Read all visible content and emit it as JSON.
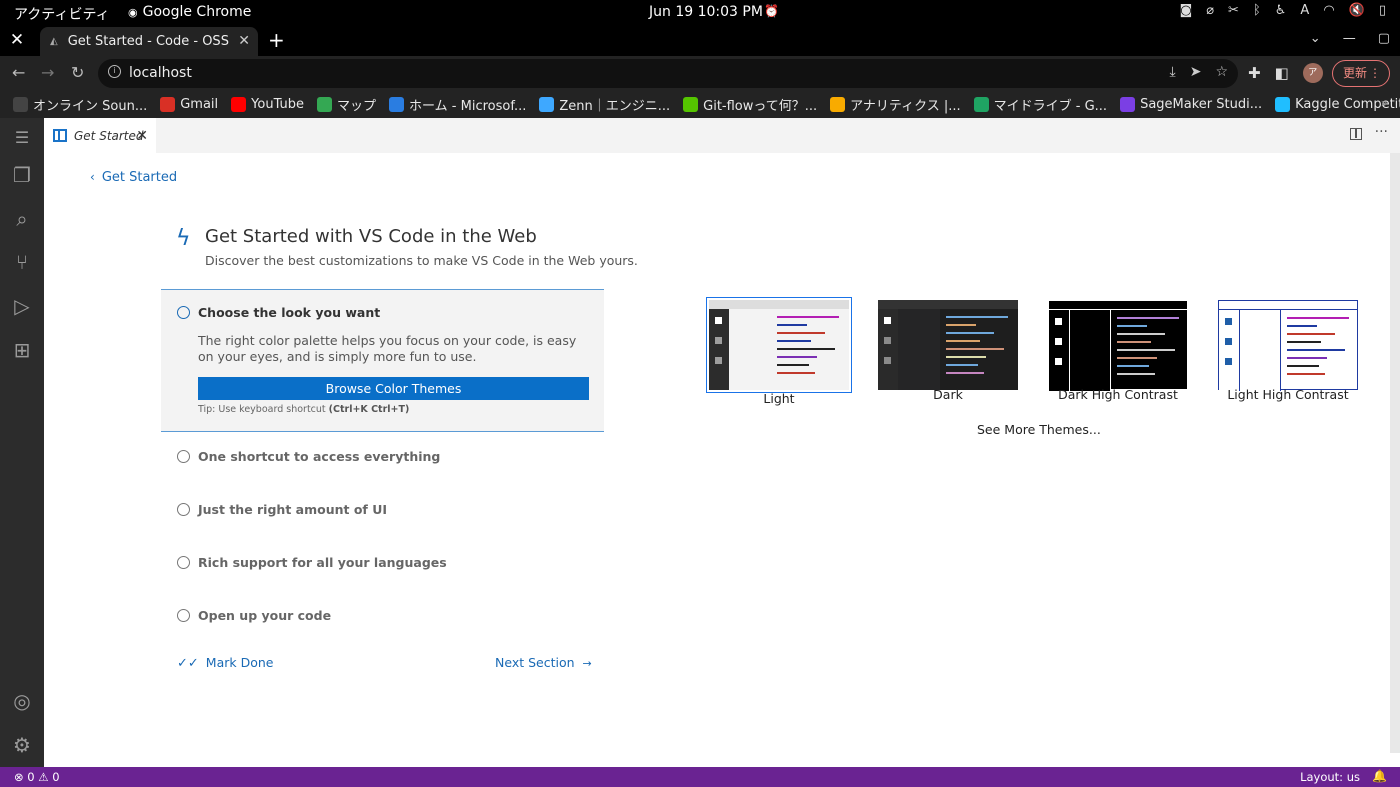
{
  "os": {
    "activities": "アクティビティ",
    "app_name": "Google Chrome",
    "clock": "Jun 19  10:03 PM",
    "input_method": "A"
  },
  "browser": {
    "tab_title": "Get Started - Code - OSS",
    "url": "localhost",
    "avatar_letter": "ア",
    "update_label": "更新",
    "bookmarks": [
      {
        "label": "オンライン Soun...",
        "icon": "globe-icon",
        "color": "#444444"
      },
      {
        "label": "Gmail",
        "icon": "gmail-icon",
        "color": "#d93025"
      },
      {
        "label": "YouTube",
        "icon": "youtube-icon",
        "color": "#ff0000"
      },
      {
        "label": "マップ",
        "icon": "maps-icon",
        "color": "#34a853"
      },
      {
        "label": "ホーム - Microsof...",
        "icon": "azure-icon",
        "color": "#2a7de1"
      },
      {
        "label": "Zenn｜エンジニ...",
        "icon": "zenn-icon",
        "color": "#3ea8ff"
      },
      {
        "label": "Git-flowって何？...",
        "icon": "qiita-icon",
        "color": "#55c500"
      },
      {
        "label": "アナリティクス |...",
        "icon": "analytics-icon",
        "color": "#f9ab00"
      },
      {
        "label": "マイドライブ - G...",
        "icon": "drive-icon",
        "color": "#1fa463"
      },
      {
        "label": "SageMaker Studi...",
        "icon": "sagemaker-icon",
        "color": "#7b3fe4"
      },
      {
        "label": "Kaggle Competit...",
        "icon": "kaggle-icon",
        "color": "#20beff"
      }
    ]
  },
  "vscode": {
    "editor_tab": "Get Started",
    "back_link": "Get Started",
    "walkthrough": {
      "title": "Get Started with VS Code in the Web",
      "subtitle": "Discover the best customizations to make VS Code in the Web yours.",
      "active_step": {
        "title": "Choose the look you want",
        "description": "The right color palette helps you focus on your code, is easy on your eyes, and is simply more fun to use.",
        "button": "Browse Color Themes",
        "tip_prefix": "Tip: Use keyboard shortcut ",
        "tip_shortcut": "(Ctrl+K Ctrl+T)"
      },
      "steps": [
        "One shortcut to access everything",
        "Just the right amount of UI",
        "Rich support for all your languages",
        "Open up your code"
      ],
      "mark_done": "Mark Done",
      "next_section": "Next Section"
    },
    "themes": [
      {
        "label": "Light",
        "selected": true
      },
      {
        "label": "Dark",
        "selected": false
      },
      {
        "label": "Dark High Contrast",
        "selected": false
      },
      {
        "label": "Light High Contrast",
        "selected": false
      }
    ],
    "see_more": "See More Themes...",
    "status": {
      "errors": "0",
      "warnings": "0",
      "layout": "Layout: us"
    },
    "accent_color": "#0a6fc8",
    "status_color": "#6a2392"
  }
}
